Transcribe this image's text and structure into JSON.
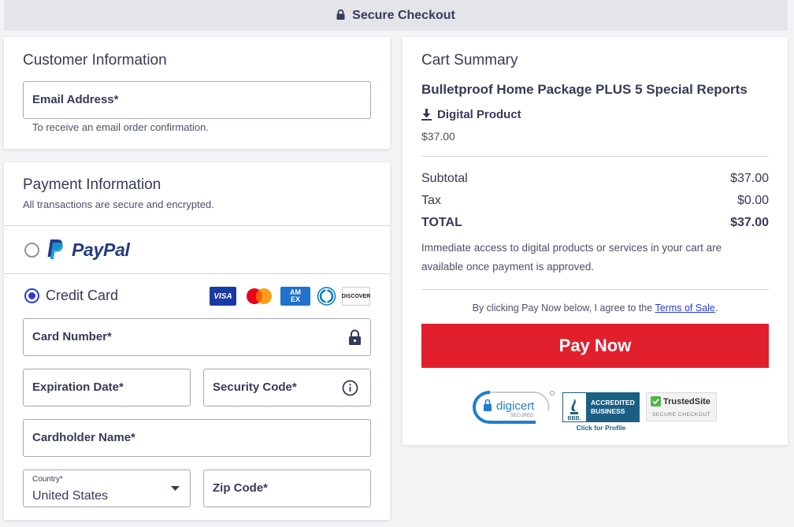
{
  "header": {
    "title": "Secure Checkout",
    "icon": "lock-icon"
  },
  "customer": {
    "title": "Customer Information",
    "email": {
      "label": "Email Address*",
      "value": ""
    },
    "email_helper": "To receive an email order confirmation."
  },
  "payment": {
    "title": "Payment Information",
    "subtitle": "All transactions are secure and encrypted.",
    "paypal": {
      "label": "PayPal",
      "selected": false
    },
    "credit_card": {
      "label": "Credit Card",
      "selected": true
    },
    "card_brands": [
      "VISA",
      "Mastercard",
      "AMEX",
      "Diners Club",
      "DISCOVER"
    ],
    "card_number": {
      "label": "Card Number*"
    },
    "expiration": {
      "label": "Expiration Date*"
    },
    "security_code": {
      "label": "Security Code*"
    },
    "cardholder": {
      "label": "Cardholder Name*"
    },
    "country": {
      "label": "Country*",
      "value": "United States"
    },
    "zip": {
      "label": "Zip Code*"
    }
  },
  "cart": {
    "title": "Cart Summary",
    "product_name": "Bulletproof Home Package PLUS 5 Special Reports",
    "product_type": "Digital Product",
    "product_price": "$37.00",
    "subtotal_label": "Subtotal",
    "subtotal_value": "$37.00",
    "tax_label": "Tax",
    "tax_value": "$0.00",
    "total_label": "TOTAL",
    "total_value": "$37.00",
    "access_note_1": "Immediate access to digital products or services in your cart are",
    "access_note_2": "available once payment is approved.",
    "terms_prefix": "By clicking Pay Now below, I agree to the ",
    "terms_link": "Terms of Sale",
    "terms_suffix": ".",
    "pay_button": "Pay Now",
    "badges": {
      "digicert": {
        "name": "digicert",
        "sub": "SECURED"
      },
      "bbb": {
        "line1": "ACCREDITED",
        "line2": "BUSINESS",
        "caption": "Click for Profile",
        "mark": "BBB."
      },
      "trustedsite": {
        "name": "TrustedSite",
        "sub": "SECURE CHECKOUT"
      }
    }
  },
  "colors": {
    "accent": "#2a3bd6",
    "pay_button": "#e21f2d",
    "text": "#363b57",
    "paypal_dark": "#253b80",
    "paypal_light": "#179bd7"
  }
}
